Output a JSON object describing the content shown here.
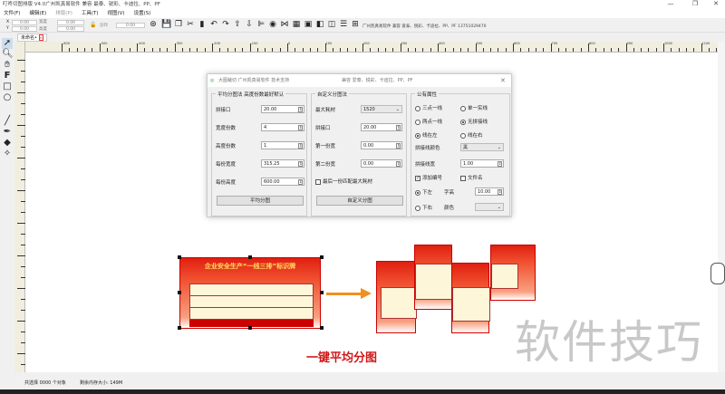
{
  "window": {
    "title": "叮咚切图排版 V4.0广州凯真易软件 兼容 最泰、锐彩、卡迪拉、PP、PF",
    "contact": "广州凯真易软件 兼容 爱泰、锐彩、卡迪拉、PP、PF 13751029470",
    "minimize": "—",
    "restore": "❐",
    "close": "✕"
  },
  "menu": [
    "文件(F)",
    "编辑(E)",
    "排版(P)",
    "工具(T)",
    "视图(V)",
    "设置(S)"
  ],
  "toolbar": {
    "x_label": "X",
    "y_label": "Y",
    "x_value": "0.00",
    "y_value": "0.00",
    "width_label": "宽度",
    "height_label": "高度",
    "width_value": "0.00",
    "height_value": "0.00",
    "rotate_label": "旋转",
    "rotate_value": "0.00"
  },
  "tab": {
    "label": "未命名•"
  },
  "ruler_labels": [
    "-600",
    "-500",
    "-400",
    "-300",
    "-200",
    "-100",
    "0",
    "100",
    "200",
    "300",
    "400",
    "500",
    "600",
    "700",
    "800",
    "900",
    "1000",
    "1100"
  ],
  "dialog": {
    "title": "大图裁切 广州凯真易软件 技术支持",
    "subtitle": "兼容 爱泰、锐彩、卡迪拉、PP、PF",
    "close": "✕",
    "avg": {
      "title": "平均分图法 高度份数最好默认",
      "fields": [
        {
          "label": "拼接口",
          "value": "20.00"
        },
        {
          "label": "宽度份数",
          "value": "4"
        },
        {
          "label": "高度份数",
          "value": "1"
        },
        {
          "label": "每份宽度",
          "value": "315.25"
        },
        {
          "label": "每份高度",
          "value": "600.00"
        }
      ],
      "button": "平均分图"
    },
    "custom": {
      "title": "自定义分图法",
      "max_label": "最大耗材",
      "max_value": "1520",
      "fields": [
        {
          "label": "拼接口",
          "value": "20.00"
        },
        {
          "label": "第一份宽",
          "value": "0.00"
        },
        {
          "label": "第二份宽",
          "value": "0.00"
        }
      ],
      "checkbox": "最后一份匹配最大耗材",
      "checkbox_checked": false,
      "button": "自定义分图"
    },
    "common": {
      "title": "公有属性",
      "radios": [
        {
          "label": "三点一线",
          "on": false
        },
        {
          "label": "单一实线",
          "on": false
        },
        {
          "label": "两点一线",
          "on": false
        },
        {
          "label": "无拼接线",
          "on": true
        },
        {
          "label": "线在左",
          "on": true
        },
        {
          "label": "线在右",
          "on": false
        }
      ],
      "line_color_label": "拼接线颜色",
      "line_color_value": "黑",
      "line_width_label": "拼接线宽",
      "line_width_value": "1.00",
      "add_number": "添加编号",
      "add_number_checked": true,
      "filename": "文件名",
      "filename_checked": false,
      "bottom_left": "下左",
      "font_size_label": "字高",
      "font_size_value": "10.00",
      "bottom_right": "下右",
      "color_label": "颜色"
    }
  },
  "canvas": {
    "card_title": "企业安全生产“一线三排”标识牌",
    "caption": "一键平均分图",
    "watermark": "软件技巧"
  },
  "status": {
    "selected": "共选择 0000 个对象",
    "memory": "剩余内存大小: 149M"
  }
}
